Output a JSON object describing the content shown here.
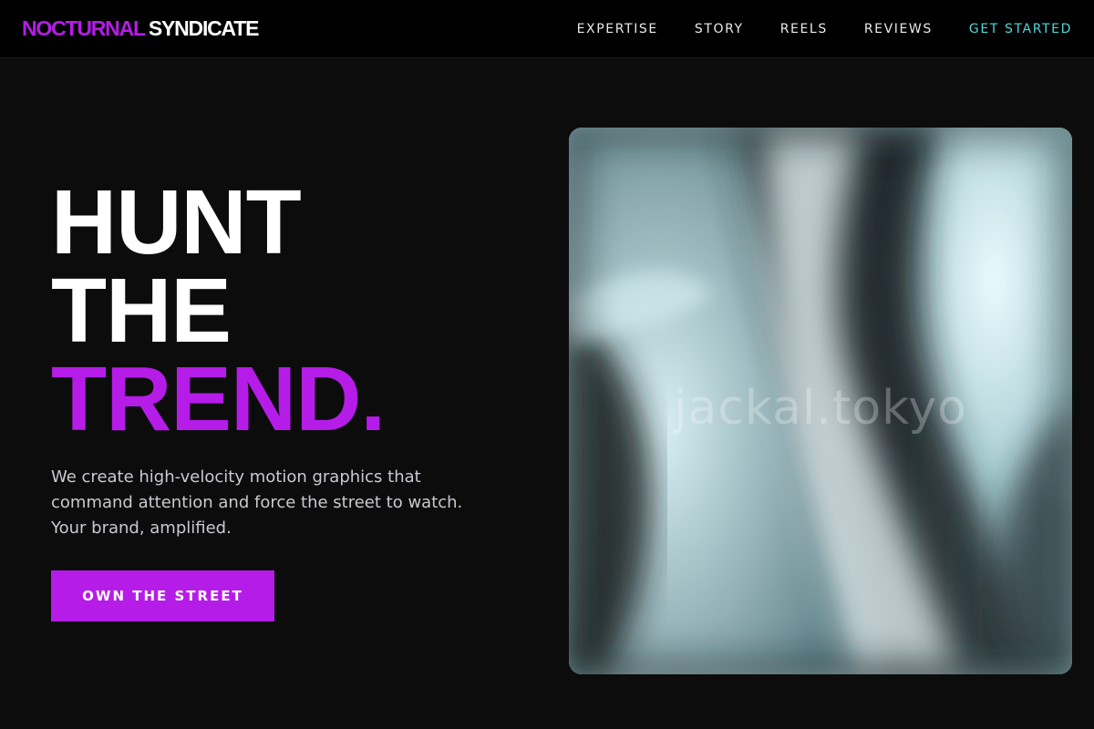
{
  "nav": {
    "logo_accent": "NOCTURNAL",
    "logo_main": "SYNDICATE",
    "links": [
      {
        "label": "EXPERTISE"
      },
      {
        "label": "STORY"
      },
      {
        "label": "REELS"
      },
      {
        "label": "REVIEWS"
      },
      {
        "label": "GET STARTED"
      }
    ]
  },
  "hero": {
    "title_lines": [
      "HUNT",
      "THE",
      "TREND."
    ],
    "description": "We create high-velocity motion graphics that command attention and force the street to watch. Your brand, amplified.",
    "cta_label": "OWN THE STREET",
    "image_watermark": "jackal.tokyo"
  },
  "colors": {
    "accent": "#b61ce8",
    "cta_link": "#4fd6d6",
    "background": "#0c0c0d",
    "nav_background": "#000000"
  }
}
